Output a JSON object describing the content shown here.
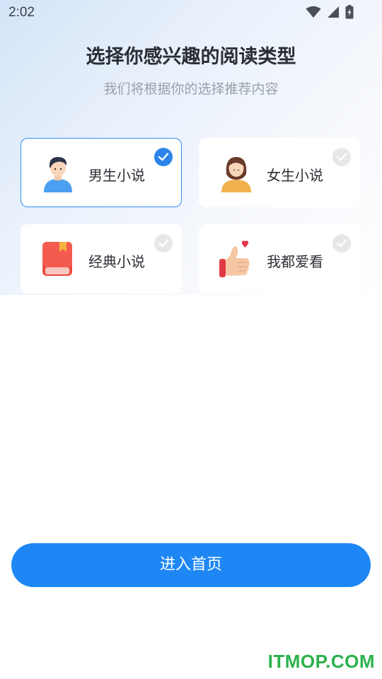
{
  "status_bar": {
    "time": "2:02",
    "icons": [
      "wifi-icon",
      "signal-icon",
      "battery-icon"
    ]
  },
  "header": {
    "title": "选择你感兴趣的阅读类型",
    "subtitle": "我们将根据你的选择推荐内容"
  },
  "categories": [
    {
      "label": "男生小说",
      "icon": "boy-avatar-icon",
      "selected": true
    },
    {
      "label": "女生小说",
      "icon": "girl-avatar-icon",
      "selected": false
    },
    {
      "label": "经典小说",
      "icon": "book-icon",
      "selected": false
    },
    {
      "label": "我都爱看",
      "icon": "thumbs-up-heart-icon",
      "selected": false
    }
  ],
  "footer": {
    "enter_label": "进入首页"
  },
  "watermark": "ITMOP.COM",
  "colors": {
    "accent": "#1e87f5",
    "check_selected": "#2c84ea",
    "check_unselected": "#e6e7e9",
    "watermark": "#2bb24c"
  }
}
